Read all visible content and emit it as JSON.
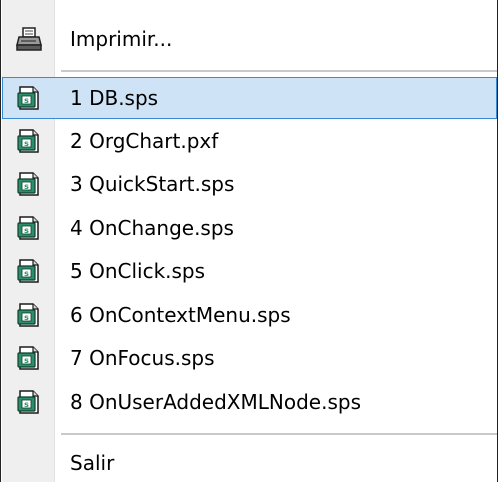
{
  "menu": {
    "print_label": "Imprimir...",
    "recent_files": [
      {
        "label": "1 DB.sps"
      },
      {
        "label": "2 OrgChart.pxf"
      },
      {
        "label": "3 QuickStart.sps"
      },
      {
        "label": "4 OnChange.sps"
      },
      {
        "label": "5 OnClick.sps"
      },
      {
        "label": "6 OnContextMenu.sps"
      },
      {
        "label": "7 OnFocus.sps"
      },
      {
        "label": "8 OnUserAddedXMLNode.sps"
      }
    ],
    "exit_label": "Salir",
    "highlighted_index": 0
  },
  "icons": {
    "print": "printer-icon",
    "file": "sps-file-icon"
  },
  "colors": {
    "highlight_bg": "#cfe3f6",
    "highlight_border": "#3a89d1",
    "gutter": "#efeff0",
    "icon_green": "#2a8f6a"
  }
}
